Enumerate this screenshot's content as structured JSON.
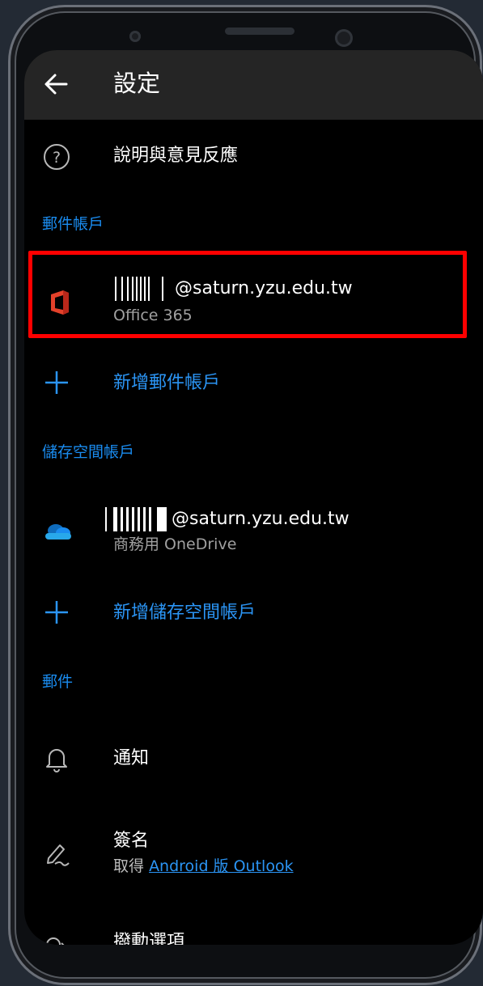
{
  "appbar": {
    "title": "設定",
    "back_icon": "arrow-left-icon"
  },
  "help_row": {
    "icon": "help-circle-icon",
    "label": "說明與意見反應"
  },
  "mail_accounts": {
    "section_label": "郵件帳戶",
    "account": {
      "icon": "office365-icon",
      "email_suffix": "@saturn.yzu.edu.tw",
      "provider": "Office 365"
    },
    "add_label": "新增郵件帳戶"
  },
  "storage_accounts": {
    "section_label": "儲存空間帳戶",
    "account": {
      "icon": "onedrive-icon",
      "email_suffix": "@saturn.yzu.edu.tw",
      "provider": "商務用 OneDrive"
    },
    "add_label": "新增儲存空間帳戶"
  },
  "mail_section": {
    "section_label": "郵件",
    "notifications": {
      "icon": "bell-icon",
      "label": "通知"
    },
    "signature": {
      "icon": "signature-pen-icon",
      "label": "簽名",
      "sub_prefix": "取得",
      "sub_link": "Android 版 Outlook"
    },
    "swipe_options_partial": "撥動選項"
  },
  "colors": {
    "accent": "#1a8cf0",
    "highlight_border": "#ff0000",
    "appbar": "#252525"
  }
}
